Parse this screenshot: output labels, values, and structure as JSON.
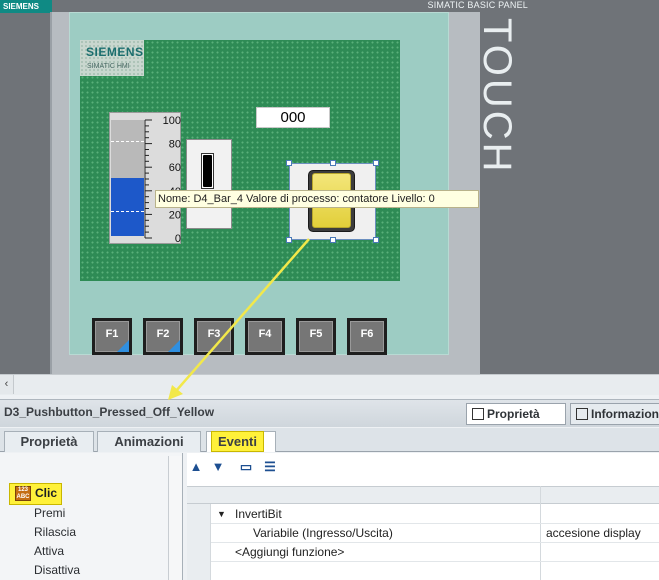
{
  "brand": {
    "corner_logo": "SIEMENS",
    "panel_model": "SIMATIC BASIC PANEL",
    "panel_side_text": "TOUCH",
    "screen_logo": "SIEMENS",
    "screen_logo_sub": "SIMATIC HMI"
  },
  "screen": {
    "counter_value": "000",
    "bar": {
      "scale_labels": [
        "100",
        "80",
        "60",
        "40",
        "20",
        "0"
      ],
      "fill_percent": 50
    },
    "tooltip": "Nome: D4_Bar_4  Valore di processo: contatore    Livello: 0",
    "function_keys": [
      {
        "label": "F1",
        "flag": true
      },
      {
        "label": "F2",
        "flag": true
      },
      {
        "label": "F3",
        "flag": false
      },
      {
        "label": "F4",
        "flag": false
      },
      {
        "label": "F5",
        "flag": false
      },
      {
        "label": "F6",
        "flag": false
      }
    ]
  },
  "scroll": {
    "left_arrow": "‹"
  },
  "inspector": {
    "object_name": "D3_Pushbutton_Pressed_Off_Yellow",
    "top_tabs": [
      "Proprietà",
      "Informazioni"
    ],
    "sub_tabs": [
      "Proprietà",
      "Animazioni",
      "Eventi"
    ],
    "events": [
      "Clic",
      "Premi",
      "Rilascia",
      "Attiva",
      "Disattiva"
    ],
    "clic_icon_text": "123 ABC",
    "toolbar_icons": [
      "move-up-icon",
      "move-down-icon",
      "folder-icon",
      "list-icon"
    ],
    "function_group": "InvertiBit",
    "function_param": "Variabile (Ingresso/Uscita)",
    "function_param_value": "accesione display",
    "add_function": "<Aggiungi funzione>"
  },
  "colors": {
    "highlight": "#fff13a",
    "screen_green": "#2e8b55",
    "bar_blue": "#1d58c9",
    "arrow": "#f2e84a"
  }
}
